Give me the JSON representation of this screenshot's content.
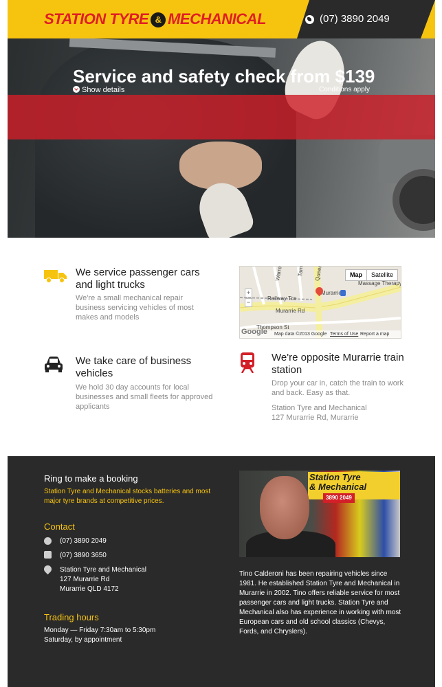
{
  "header": {
    "logo_left": "STATION TYRE",
    "logo_amp": "&",
    "logo_right": "MECHANICAL",
    "phone": "(07) 3890 2049"
  },
  "hero": {
    "title": "Service and safety check from $139",
    "show_details": "Show details",
    "conditions": "Conditions apply"
  },
  "features": {
    "passenger": {
      "title": "We service passenger cars and light trucks",
      "body": "We're a small mechanical repair business servicing vehicles of most makes and models"
    },
    "business": {
      "title": "We take care of business vehicles",
      "body": "We hold 30 day accounts for local businesses and small fleets for approved applicants"
    },
    "train": {
      "title": "We're opposite Murarrie train station",
      "body": "Drop your car in, catch the train to work and back. Easy as that.",
      "address_line1": "Station Tyre and Mechanical",
      "address_line2": "127 Murarrie Rd, Murarrie"
    }
  },
  "map": {
    "btn_map": "Map",
    "btn_satellite": "Satellite",
    "zoom_in": "+",
    "zoom_out": "−",
    "labels": {
      "railway": "Railway Tce",
      "murarrie_rd": "Murarrie Rd",
      "murarrie": "Murarrie",
      "massage": "Massage Therapy",
      "queensport": "Queensport",
      "warrel": "Warrel",
      "tam": "Tam",
      "thompson": "Thompson St"
    },
    "google": "Google",
    "map_data": "Map data ©2013 Google",
    "terms": "Terms of Use",
    "report": "Report a map error"
  },
  "footer": {
    "booking_title": "Ring to make a booking",
    "booking_body": "Station Tyre and Mechanical stocks batteries and most major tyre brands at competitive prices.",
    "contact_title": "Contact",
    "phone": "(07) 3890 2049",
    "fax": "(07) 3890 3650",
    "address1": "Station Tyre and Mechanical",
    "address2": "127 Murarrie Rd",
    "address3": "Murarrie QLD 4172",
    "hours_title": "Trading hours",
    "hours1": "Monday — Friday 7:30am to 5:30pm",
    "hours2": "Saturday, by appointment",
    "bio": "Tino Calderoni has been repairing vehicles since 1981. He established Station Tyre and Mechanical in Murarrie in 2002. Tino offers reliable service for most passenger cars and light trucks. Station Tyre and Mechanical also has experience in working with most European cars and old school classics (Chevys, Fords, and Chryslers).",
    "photo_sign_line1": "Station Tyre",
    "photo_sign_line2": "& Mechanical",
    "photo_sign_phone": "3890 2049"
  },
  "colors": {
    "brand_yellow": "#f6c40f",
    "brand_red": "#e01e24",
    "dark": "#2b2a2b"
  }
}
